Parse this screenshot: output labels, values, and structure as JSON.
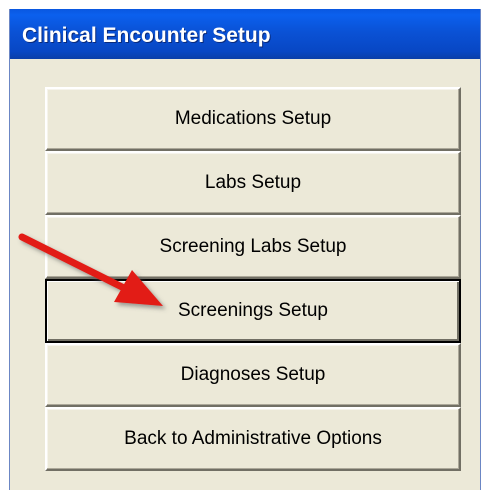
{
  "window": {
    "title": "Clinical Encounter Setup"
  },
  "buttons": [
    {
      "label": "Medications Setup"
    },
    {
      "label": "Labs Setup"
    },
    {
      "label": "Screening Labs Setup"
    },
    {
      "label": "Screenings Setup"
    },
    {
      "label": "Diagnoses Setup"
    },
    {
      "label": "Back to Administrative Options"
    }
  ],
  "annotation": {
    "icon": "red-arrow-icon",
    "color": "#e21b13"
  },
  "colors": {
    "titlebar": "#0a52d6",
    "window_bg": "#ece9d8"
  }
}
